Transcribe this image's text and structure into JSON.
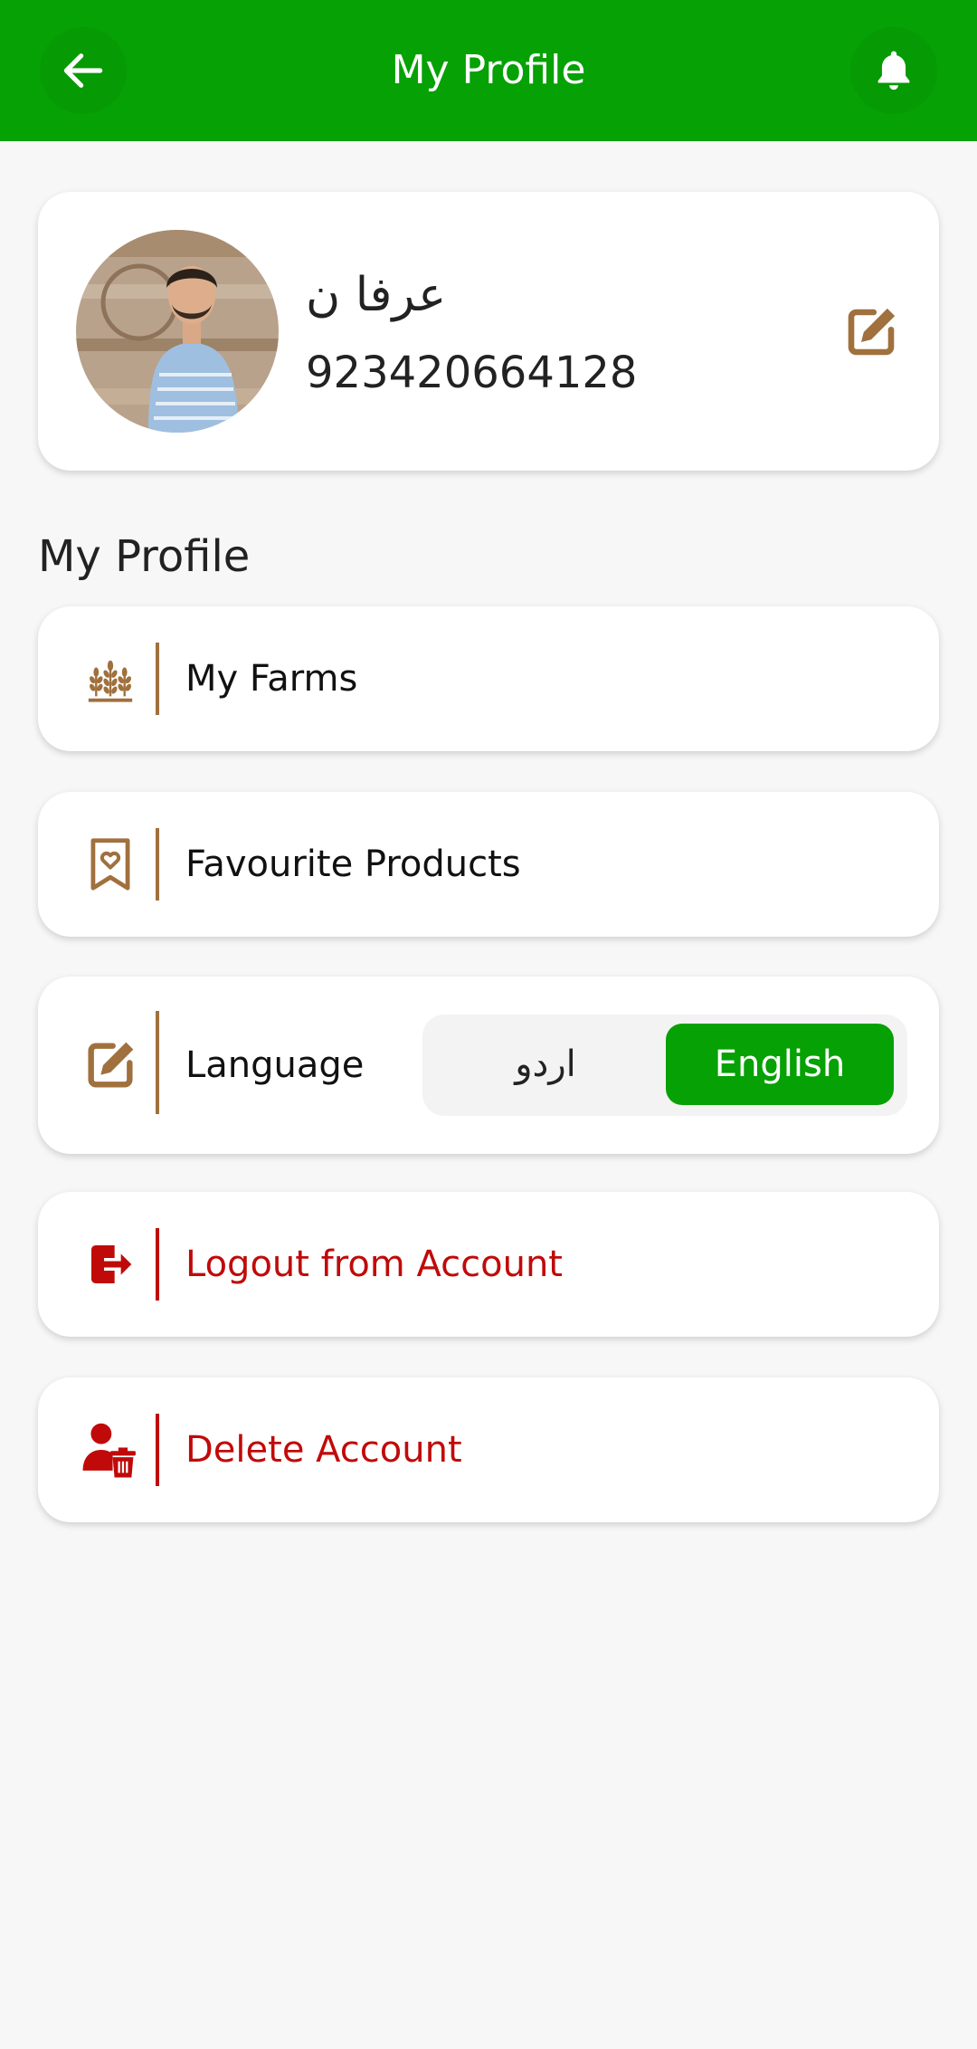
{
  "header": {
    "title": "My Profile",
    "back_icon": "arrow-left-icon",
    "notification_icon": "bell-icon"
  },
  "profile": {
    "name": "عرفا ن",
    "phone": "923420664128",
    "edit_icon": "edit-icon"
  },
  "section": {
    "title": "My Profile"
  },
  "menu": {
    "my_farms": {
      "label": "My Farms",
      "icon": "wheat-icon"
    },
    "favourites": {
      "label": "Favourite Products",
      "icon": "bookmark-heart-icon"
    },
    "language": {
      "label": "Language",
      "icon": "edit-icon",
      "options": [
        "اردو",
        "English"
      ],
      "selected": "English"
    },
    "logout": {
      "label": "Logout from Account",
      "icon": "logout-icon"
    },
    "delete": {
      "label": "Delete Account",
      "icon": "user-delete-icon"
    }
  },
  "colors": {
    "primary": "#06a104",
    "accent_brown": "#a0703d",
    "danger": "#c00a0a"
  }
}
